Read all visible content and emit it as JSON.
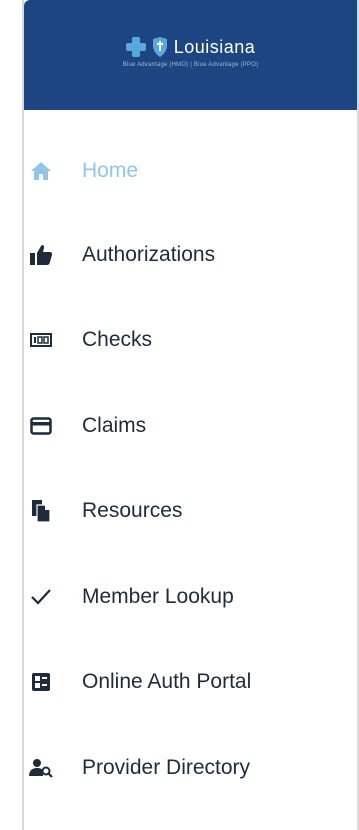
{
  "brand": {
    "name": "Louisiana",
    "subtitle": "Blue Advantage (HMO) | Blue Advantage (PPO)"
  },
  "colors": {
    "header_bg": "#1d4582",
    "active": "#93c4ea",
    "text": "#1f2b3a"
  },
  "nav": {
    "items": [
      {
        "label": "Home",
        "icon": "home-icon",
        "active": true
      },
      {
        "label": "Authorizations",
        "icon": "thumbs-up-icon",
        "active": false
      },
      {
        "label": "Checks",
        "icon": "check-money-icon",
        "active": false
      },
      {
        "label": "Claims",
        "icon": "card-icon",
        "active": false
      },
      {
        "label": "Resources",
        "icon": "document-copy-icon",
        "active": false
      },
      {
        "label": "Member Lookup",
        "icon": "checkmark-icon",
        "active": false
      },
      {
        "label": "Online Auth Portal",
        "icon": "id-card-icon",
        "active": false
      },
      {
        "label": "Provider Directory",
        "icon": "user-search-icon",
        "active": false
      }
    ]
  }
}
